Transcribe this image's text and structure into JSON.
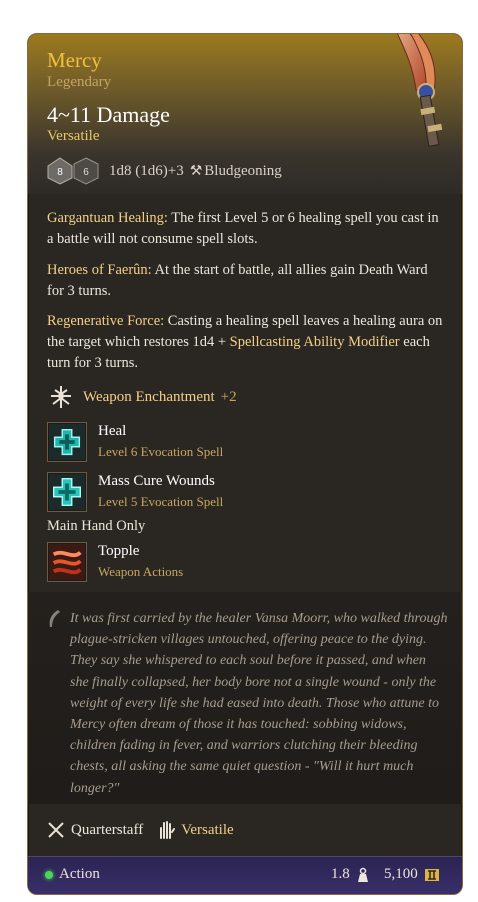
{
  "item": {
    "name": "Mercy",
    "rarity": "Legendary",
    "damage": "4~11 Damage",
    "property": "Versatile",
    "dice_formula": "1d8 (1d6)+3",
    "damage_type": "Bludgeoning",
    "die_values": [
      "8",
      "6"
    ],
    "rarity_color": "#f0c040"
  },
  "passives": [
    {
      "name": "Gargantuan Healing:",
      "text": " The first Level 5 or 6 healing spell you cast in a battle will not consume spell slots."
    },
    {
      "name": "Heroes of Faerûn:",
      "text": " At the start of battle, all allies gain Death Ward for 3 turns."
    },
    {
      "name": "Regenerative Force:",
      "text": " Casting a healing spell leaves a healing aura on the target which restores 1d4 + ",
      "link": "Spellcasting Ability Modifier",
      "tail": " each turn for 3 turns."
    }
  ],
  "enchantment": {
    "label": "Weapon Enchantment",
    "bonus": "+2",
    "icon": "enchantment-icon"
  },
  "spells": [
    {
      "title": "Heal",
      "subtitle": "Level 6 Evocation Spell",
      "icon": "heal-spell-icon"
    },
    {
      "title": "Mass Cure Wounds",
      "subtitle": "Level 5 Evocation Spell",
      "icon": "mass-cure-wounds-icon"
    }
  ],
  "main_hand_label": "Main Hand Only",
  "actions": [
    {
      "title": "Topple",
      "subtitle": "Weapon Actions",
      "icon": "topple-icon"
    }
  ],
  "lore": "It was first carried by the healer Vansa Moorr, who walked through plague-stricken villages untouched, offering peace to the dying. They say she whispered to each soul before it passed, and when she finally collapsed, her body bore not a single wound - only the weight of every life she had eased into death. Those who attune to Mercy often dream of those it has touched: sobbing widows, children fading in fever, and warriors clutching their bleeding chests, all asking the same quiet question - \"Will it hurt much longer?\"",
  "traits": {
    "weapon_type": "Quarterstaff",
    "property": "Versatile"
  },
  "footer": {
    "action": "Action",
    "weight": "1.8",
    "price": "5,100"
  }
}
